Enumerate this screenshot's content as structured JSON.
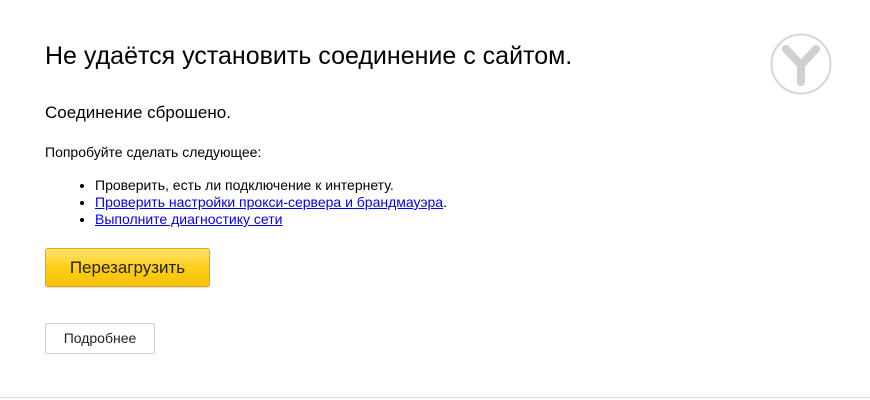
{
  "error": {
    "title": "Не удаётся установить соединение с сайтом.",
    "subtitle": "Соединение сброшено.",
    "suggestions_intro": "Попробуйте сделать следующее:",
    "suggestions": [
      {
        "text": "Проверить, есть ли подключение к интернету.",
        "link": false
      },
      {
        "text": "Проверить настройки прокси-сервера и брандмауэра",
        "suffix": ".",
        "link": true
      },
      {
        "text": "Выполните диагностику сети",
        "link": true
      }
    ]
  },
  "buttons": {
    "reload_label": "Перезагрузить",
    "details_label": "Подробнее"
  },
  "branding": {
    "logo_icon": "yandex-browser-logo-icon"
  },
  "colors": {
    "reload_button": "#fccd13",
    "link": "#0000ee"
  }
}
